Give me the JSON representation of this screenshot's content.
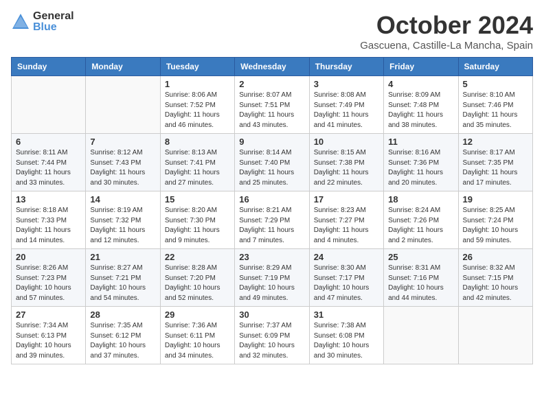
{
  "header": {
    "logo_general": "General",
    "logo_blue": "Blue",
    "month_title": "October 2024",
    "location": "Gascuena, Castille-La Mancha, Spain"
  },
  "columns": [
    "Sunday",
    "Monday",
    "Tuesday",
    "Wednesday",
    "Thursday",
    "Friday",
    "Saturday"
  ],
  "weeks": [
    [
      {
        "day": "",
        "info": ""
      },
      {
        "day": "",
        "info": ""
      },
      {
        "day": "1",
        "info": "Sunrise: 8:06 AM\nSunset: 7:52 PM\nDaylight: 11 hours and 46 minutes."
      },
      {
        "day": "2",
        "info": "Sunrise: 8:07 AM\nSunset: 7:51 PM\nDaylight: 11 hours and 43 minutes."
      },
      {
        "day": "3",
        "info": "Sunrise: 8:08 AM\nSunset: 7:49 PM\nDaylight: 11 hours and 41 minutes."
      },
      {
        "day": "4",
        "info": "Sunrise: 8:09 AM\nSunset: 7:48 PM\nDaylight: 11 hours and 38 minutes."
      },
      {
        "day": "5",
        "info": "Sunrise: 8:10 AM\nSunset: 7:46 PM\nDaylight: 11 hours and 35 minutes."
      }
    ],
    [
      {
        "day": "6",
        "info": "Sunrise: 8:11 AM\nSunset: 7:44 PM\nDaylight: 11 hours and 33 minutes."
      },
      {
        "day": "7",
        "info": "Sunrise: 8:12 AM\nSunset: 7:43 PM\nDaylight: 11 hours and 30 minutes."
      },
      {
        "day": "8",
        "info": "Sunrise: 8:13 AM\nSunset: 7:41 PM\nDaylight: 11 hours and 27 minutes."
      },
      {
        "day": "9",
        "info": "Sunrise: 8:14 AM\nSunset: 7:40 PM\nDaylight: 11 hours and 25 minutes."
      },
      {
        "day": "10",
        "info": "Sunrise: 8:15 AM\nSunset: 7:38 PM\nDaylight: 11 hours and 22 minutes."
      },
      {
        "day": "11",
        "info": "Sunrise: 8:16 AM\nSunset: 7:36 PM\nDaylight: 11 hours and 20 minutes."
      },
      {
        "day": "12",
        "info": "Sunrise: 8:17 AM\nSunset: 7:35 PM\nDaylight: 11 hours and 17 minutes."
      }
    ],
    [
      {
        "day": "13",
        "info": "Sunrise: 8:18 AM\nSunset: 7:33 PM\nDaylight: 11 hours and 14 minutes."
      },
      {
        "day": "14",
        "info": "Sunrise: 8:19 AM\nSunset: 7:32 PM\nDaylight: 11 hours and 12 minutes."
      },
      {
        "day": "15",
        "info": "Sunrise: 8:20 AM\nSunset: 7:30 PM\nDaylight: 11 hours and 9 minutes."
      },
      {
        "day": "16",
        "info": "Sunrise: 8:21 AM\nSunset: 7:29 PM\nDaylight: 11 hours and 7 minutes."
      },
      {
        "day": "17",
        "info": "Sunrise: 8:23 AM\nSunset: 7:27 PM\nDaylight: 11 hours and 4 minutes."
      },
      {
        "day": "18",
        "info": "Sunrise: 8:24 AM\nSunset: 7:26 PM\nDaylight: 11 hours and 2 minutes."
      },
      {
        "day": "19",
        "info": "Sunrise: 8:25 AM\nSunset: 7:24 PM\nDaylight: 10 hours and 59 minutes."
      }
    ],
    [
      {
        "day": "20",
        "info": "Sunrise: 8:26 AM\nSunset: 7:23 PM\nDaylight: 10 hours and 57 minutes."
      },
      {
        "day": "21",
        "info": "Sunrise: 8:27 AM\nSunset: 7:21 PM\nDaylight: 10 hours and 54 minutes."
      },
      {
        "day": "22",
        "info": "Sunrise: 8:28 AM\nSunset: 7:20 PM\nDaylight: 10 hours and 52 minutes."
      },
      {
        "day": "23",
        "info": "Sunrise: 8:29 AM\nSunset: 7:19 PM\nDaylight: 10 hours and 49 minutes."
      },
      {
        "day": "24",
        "info": "Sunrise: 8:30 AM\nSunset: 7:17 PM\nDaylight: 10 hours and 47 minutes."
      },
      {
        "day": "25",
        "info": "Sunrise: 8:31 AM\nSunset: 7:16 PM\nDaylight: 10 hours and 44 minutes."
      },
      {
        "day": "26",
        "info": "Sunrise: 8:32 AM\nSunset: 7:15 PM\nDaylight: 10 hours and 42 minutes."
      }
    ],
    [
      {
        "day": "27",
        "info": "Sunrise: 7:34 AM\nSunset: 6:13 PM\nDaylight: 10 hours and 39 minutes."
      },
      {
        "day": "28",
        "info": "Sunrise: 7:35 AM\nSunset: 6:12 PM\nDaylight: 10 hours and 37 minutes."
      },
      {
        "day": "29",
        "info": "Sunrise: 7:36 AM\nSunset: 6:11 PM\nDaylight: 10 hours and 34 minutes."
      },
      {
        "day": "30",
        "info": "Sunrise: 7:37 AM\nSunset: 6:09 PM\nDaylight: 10 hours and 32 minutes."
      },
      {
        "day": "31",
        "info": "Sunrise: 7:38 AM\nSunset: 6:08 PM\nDaylight: 10 hours and 30 minutes."
      },
      {
        "day": "",
        "info": ""
      },
      {
        "day": "",
        "info": ""
      }
    ]
  ]
}
